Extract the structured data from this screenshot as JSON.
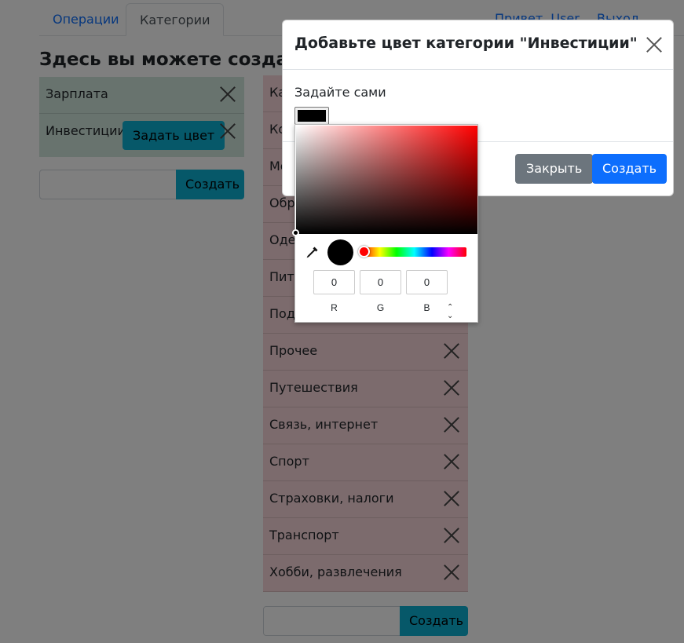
{
  "nav": {
    "tabs": [
      {
        "label": "Операции"
      },
      {
        "label": "Категории"
      }
    ],
    "greeting": "Привет, User",
    "logout": "Выход"
  },
  "page": {
    "title": "Здесь вы можете создать и"
  },
  "income": {
    "items": [
      {
        "label": "Зарплата"
      },
      {
        "label": "Инвестиции"
      }
    ],
    "set_color_label": "Задать цвет",
    "create_label": "Создать",
    "input_value": ""
  },
  "expenses": {
    "items": [
      {
        "label": "Ка"
      },
      {
        "label": "Ко"
      },
      {
        "label": "Ме"
      },
      {
        "label": "Обр"
      },
      {
        "label": "Оде"
      },
      {
        "label": "Пита"
      },
      {
        "label": "Пода"
      },
      {
        "label": "Прочее"
      },
      {
        "label": "Путешествия"
      },
      {
        "label": "Связь, интернет"
      },
      {
        "label": "Спорт"
      },
      {
        "label": "Страховки, налоги"
      },
      {
        "label": "Транспорт"
      },
      {
        "label": "Хобби, развлечения"
      }
    ],
    "create_label": "Создать",
    "input_value": ""
  },
  "modal": {
    "title": "Добавьте цвет категории \"Инвестиции\"",
    "label": "Задайте сами",
    "color_value": "#000000",
    "close_label": "Закрыть",
    "create_label": "Создать"
  },
  "picker": {
    "hue": "#ff0000",
    "current_color": "#000000",
    "r": "0",
    "g": "0",
    "b": "0",
    "r_label": "R",
    "g_label": "G",
    "b_label": "B",
    "mode_toggle_icon": "up-down-chevron-icon",
    "eyedropper_icon": "eyedropper-icon"
  },
  "colors": {
    "income_row": "#d1e7dd",
    "expense_row": "#f8d7da",
    "info_button": "#0dcaf0",
    "primary": "#0d6efd",
    "secondary": "#6c757d"
  }
}
